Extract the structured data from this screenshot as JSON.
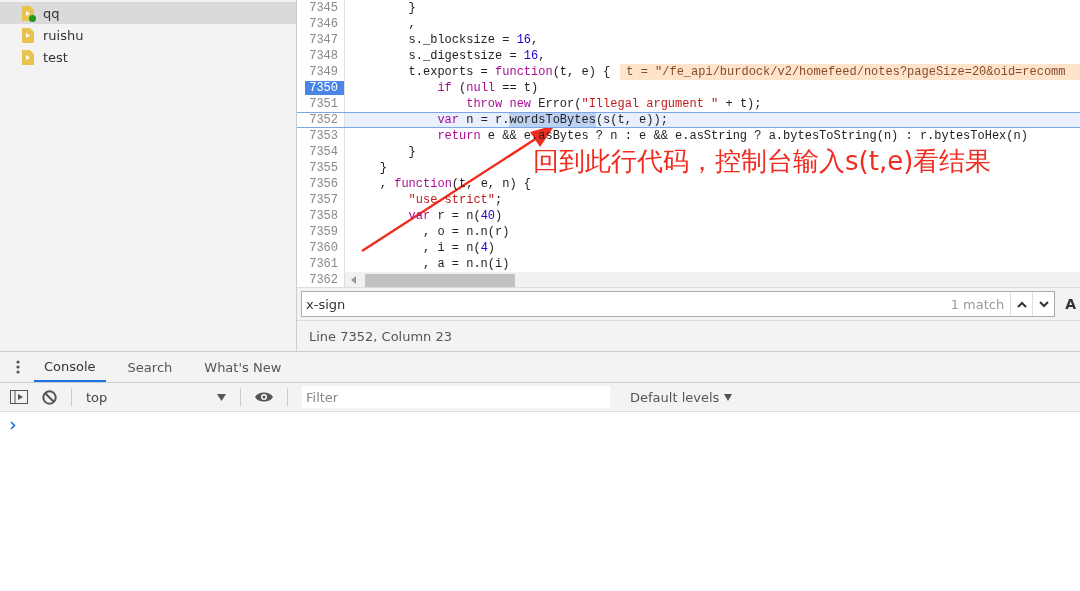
{
  "sidebar": {
    "items": [
      {
        "label": "qq",
        "selected": true,
        "dot": true
      },
      {
        "label": "ruishu",
        "selected": false,
        "dot": false
      },
      {
        "label": "test",
        "selected": false,
        "dot": false
      }
    ]
  },
  "editor": {
    "lines": [
      {
        "number": "7345",
        "breakpoint": false,
        "current": false,
        "tokens": [
          {
            "text": "        }",
            "kind": "plain"
          }
        ]
      },
      {
        "number": "7346",
        "breakpoint": false,
        "current": false,
        "tokens": [
          {
            "text": "        ,",
            "kind": "plain"
          }
        ]
      },
      {
        "number": "7347",
        "breakpoint": false,
        "current": false,
        "tokens": [
          {
            "text": "        s._blocksize = ",
            "kind": "plain"
          },
          {
            "text": "16",
            "kind": "num"
          },
          {
            "text": ",",
            "kind": "plain"
          }
        ]
      },
      {
        "number": "7348",
        "breakpoint": false,
        "current": false,
        "tokens": [
          {
            "text": "        s._digestsize = ",
            "kind": "plain"
          },
          {
            "text": "16",
            "kind": "num"
          },
          {
            "text": ",",
            "kind": "plain"
          }
        ]
      },
      {
        "number": "7349",
        "breakpoint": false,
        "current": false,
        "tokens": [
          {
            "text": "        t.exports = ",
            "kind": "plain"
          },
          {
            "text": "function",
            "kind": "kw"
          },
          {
            "text": "(t, e) {",
            "kind": "plain"
          }
        ],
        "inline_value": "t = \"/fe_api/burdock/v2/homefeed/notes?pageSize=20&oid=recomm"
      },
      {
        "number": "7350",
        "breakpoint": true,
        "current": false,
        "tokens": [
          {
            "text": "            if",
            "kind": "kw"
          },
          {
            "text": " (",
            "kind": "plain"
          },
          {
            "text": "null",
            "kind": "kw"
          },
          {
            "text": " == t)",
            "kind": "plain"
          }
        ]
      },
      {
        "number": "7351",
        "breakpoint": false,
        "current": false,
        "tokens": [
          {
            "text": "                throw new",
            "kind": "kw"
          },
          {
            "text": " Error(",
            "kind": "plain"
          },
          {
            "text": "\"Illegal argument \"",
            "kind": "str"
          },
          {
            "text": " + t);",
            "kind": "plain"
          }
        ]
      },
      {
        "number": "7352",
        "breakpoint": false,
        "current": true,
        "tokens": [
          {
            "text": "            var",
            "kind": "kw"
          },
          {
            "text": " n = r.",
            "kind": "plain"
          },
          {
            "text": "wordsToBytes",
            "kind": "match"
          },
          {
            "text": "(s(t, e));",
            "kind": "plain"
          }
        ]
      },
      {
        "number": "7353",
        "breakpoint": false,
        "current": false,
        "tokens": [
          {
            "text": "            return",
            "kind": "kw"
          },
          {
            "text": " e && e.asBytes ? n : e && e.asString ? a.bytesToString(n) : r.bytesToHex(n)",
            "kind": "plain"
          }
        ]
      },
      {
        "number": "7354",
        "breakpoint": false,
        "current": false,
        "tokens": [
          {
            "text": "        }",
            "kind": "plain"
          }
        ]
      },
      {
        "number": "7355",
        "breakpoint": false,
        "current": false,
        "tokens": [
          {
            "text": "    }",
            "kind": "plain"
          }
        ]
      },
      {
        "number": "7356",
        "breakpoint": false,
        "current": false,
        "tokens": [
          {
            "text": "    , ",
            "kind": "plain"
          },
          {
            "text": "function",
            "kind": "kw"
          },
          {
            "text": "(t, e, n) {",
            "kind": "plain"
          }
        ]
      },
      {
        "number": "7357",
        "breakpoint": false,
        "current": false,
        "tokens": [
          {
            "text": "        \"use strict\"",
            "kind": "str"
          },
          {
            "text": ";",
            "kind": "plain"
          }
        ]
      },
      {
        "number": "7358",
        "breakpoint": false,
        "current": false,
        "tokens": [
          {
            "text": "        var",
            "kind": "kw"
          },
          {
            "text": " r = n(",
            "kind": "plain"
          },
          {
            "text": "40",
            "kind": "num"
          },
          {
            "text": ")",
            "kind": "plain"
          }
        ]
      },
      {
        "number": "7359",
        "breakpoint": false,
        "current": false,
        "tokens": [
          {
            "text": "          , o = n.n(r)",
            "kind": "plain"
          }
        ]
      },
      {
        "number": "7360",
        "breakpoint": false,
        "current": false,
        "tokens": [
          {
            "text": "          , i = n(",
            "kind": "plain"
          },
          {
            "text": "4",
            "kind": "num"
          },
          {
            "text": ")",
            "kind": "plain"
          }
        ]
      },
      {
        "number": "7361",
        "breakpoint": false,
        "current": false,
        "tokens": [
          {
            "text": "          , a = n.n(i)",
            "kind": "plain"
          }
        ]
      }
    ],
    "last_line_number": "7362"
  },
  "search": {
    "value": "x-sign",
    "matches": "1 match",
    "case_button": "A"
  },
  "status_bar": "Line 7352, Column 23",
  "drawer": {
    "tabs": [
      {
        "label": "Console",
        "selected": true
      },
      {
        "label": "Search",
        "selected": false
      },
      {
        "label": "What's New",
        "selected": false
      }
    ],
    "context": "top",
    "filter_placeholder": "Filter",
    "levels": "Default levels"
  },
  "annotation": "回到此行代码，控制台输入s(t,e)看结果"
}
